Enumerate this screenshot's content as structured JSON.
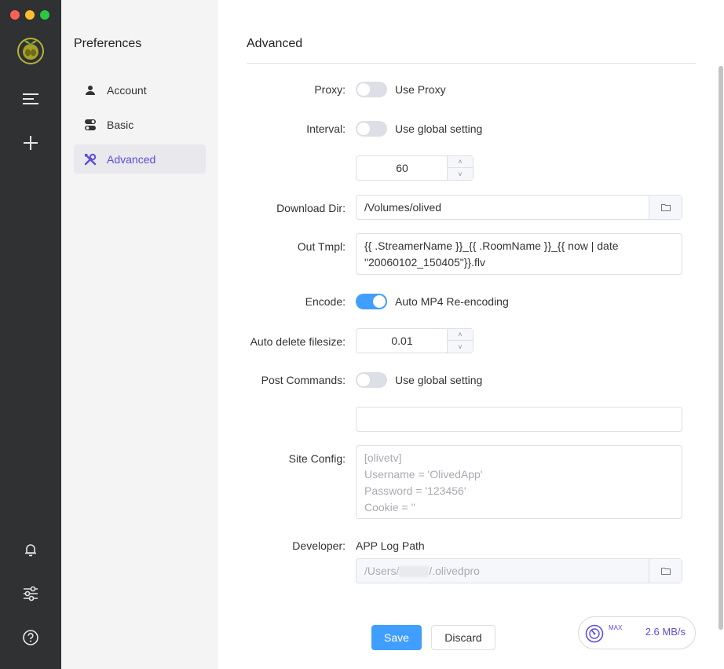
{
  "sidebar_nav": {
    "items": [
      {
        "icon": "menu-icon"
      },
      {
        "icon": "plus-icon"
      },
      {
        "icon": "bell-icon"
      },
      {
        "icon": "sliders-icon"
      },
      {
        "icon": "help-icon"
      }
    ]
  },
  "preferences": {
    "title": "Preferences",
    "items": [
      {
        "label": "Account",
        "icon": "user-icon"
      },
      {
        "label": "Basic",
        "icon": "toggles-icon"
      },
      {
        "label": "Advanced",
        "icon": "tools-icon",
        "active": true
      }
    ]
  },
  "advanced": {
    "title": "Advanced",
    "proxy": {
      "label": "Proxy:",
      "toggle_text": "Use Proxy",
      "on": false
    },
    "interval": {
      "label": "Interval:",
      "toggle_text": "Use global setting",
      "on": false,
      "value": "60"
    },
    "download_dir": {
      "label": "Download Dir:",
      "value": "/Volumes/olived"
    },
    "out_tmpl": {
      "label": "Out Tmpl:",
      "lines": [
        "{{ .StreamerName }}_{{ .RoomName }}_{{ now | date",
        "\"20060102_150405\"}}.flv"
      ]
    },
    "encode": {
      "label": "Encode:",
      "toggle_text": "Auto MP4 Re-encoding",
      "on": true
    },
    "auto_delete": {
      "label": "Auto delete filesize:",
      "value": "0.01"
    },
    "post_commands": {
      "label": "Post Commands:",
      "toggle_text": "Use global setting",
      "on": false,
      "value": ""
    },
    "site_config": {
      "label": "Site Config:",
      "placeholder_lines": [
        "[olivetv]",
        "Username = 'OlivedApp'",
        "Password = '123456'",
        "Cookie = ''"
      ]
    },
    "developer": {
      "label": "Developer:",
      "sub_label": "APP Log Path",
      "log_path_start": "/Users/",
      "log_path_end": "/.olivedpro"
    },
    "save_label": "Save",
    "discard_label": "Discard"
  },
  "speed": {
    "max_label": "MAX",
    "rate": "2.6 MB/s"
  },
  "colors": {
    "accent": "#409eff",
    "active_nav": "#5b4fdc",
    "rail": "#2f3133"
  }
}
